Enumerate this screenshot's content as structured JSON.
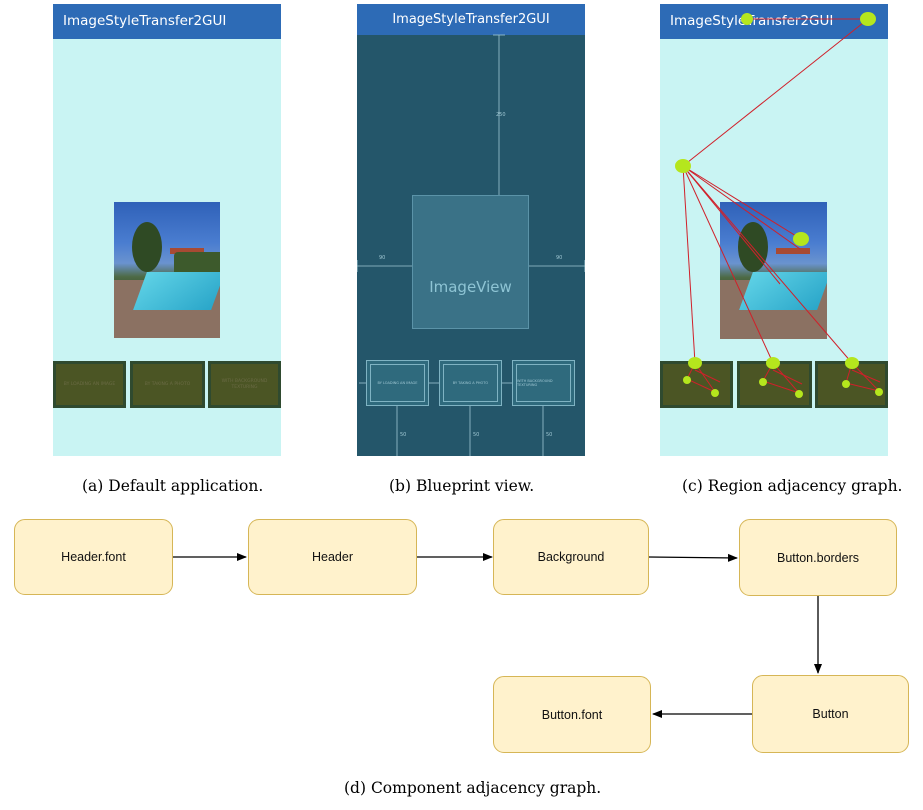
{
  "panel_a": {
    "app_title": "ImageStyleTransfer2GUI",
    "buttons": [
      "BY LOADING AN IMAGE",
      "BY TAKING A PHOTO",
      "WITH BACKGROUND TEXTURING"
    ],
    "caption": "(a) Default application."
  },
  "panel_b": {
    "app_title": "ImageStyleTransfer2GUI",
    "image_view_label": "ImageView",
    "dims": {
      "top": "250",
      "left": "90",
      "right": "90",
      "bottom1": "50",
      "bottom2": "50",
      "bottom3": "50"
    },
    "buttons": [
      "BY LOADING AN IMAGE",
      "BY TAKING A PHOTO",
      "WITH BACKGROUND TEXTURING"
    ],
    "caption": "(b) Blueprint view."
  },
  "panel_c": {
    "app_title": "ImageStyleTransfer2GUI",
    "buttons": [
      "",
      "",
      ""
    ],
    "caption": "(c) Region adjacency graph."
  },
  "panel_d": {
    "nodes": {
      "header_font": "Header.font",
      "header": "Header",
      "background": "Background",
      "button_borders": "Button.borders",
      "button": "Button",
      "button_font": "Button.font"
    },
    "caption": "(d) Component adjacency graph."
  },
  "colors": {
    "appbar": "#2d6bb6",
    "app_background": "#c9f4f3",
    "blueprint": "#24566a",
    "node_fill": "#fff2cc",
    "node_border": "#d6b656",
    "graph_node": "#b5e61d",
    "graph_edge": "#d0202a"
  }
}
